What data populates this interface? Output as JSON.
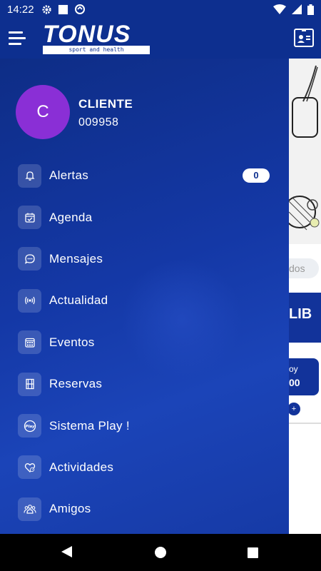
{
  "status_bar": {
    "time": "14:22",
    "icons": [
      "gear-icon",
      "square-notification-icon",
      "data-saver-icon",
      "wifi-icon",
      "cell-signal-icon",
      "battery-icon"
    ]
  },
  "app_bar": {
    "logo_text": "TONUS",
    "logo_tagline": "sport and health",
    "left_icon": "hamburger-menu-icon",
    "right_icon": "member-card-icon"
  },
  "profile": {
    "avatar_letter": "C",
    "avatar_color": "#8a2fd6",
    "name": "CLIENTE",
    "id": "009958"
  },
  "menu": {
    "items": [
      {
        "label": "Alertas",
        "icon": "bell-icon",
        "badge": "0"
      },
      {
        "label": "Agenda",
        "icon": "calendar-check-icon"
      },
      {
        "label": "Mensajes",
        "icon": "chat-bubble-icon"
      },
      {
        "label": "Actualidad",
        "icon": "broadcast-icon"
      },
      {
        "label": "Eventos",
        "icon": "calendar-grid-icon"
      },
      {
        "label": "Reservas",
        "icon": "court-icon"
      },
      {
        "label": "Sistema Play !",
        "icon": "play-logo-icon"
      },
      {
        "label": "Actividades",
        "icon": "heart-icon"
      },
      {
        "label": "Amigos",
        "icon": "friends-icon"
      }
    ]
  },
  "background_fragments": {
    "chip": "dos",
    "banner": "LIB",
    "card_line1": "oy",
    "card_line2": "00"
  },
  "colors": {
    "primary": "#0d2f8f",
    "drawer": "#1438a6",
    "avatar": "#8a2fd6"
  }
}
